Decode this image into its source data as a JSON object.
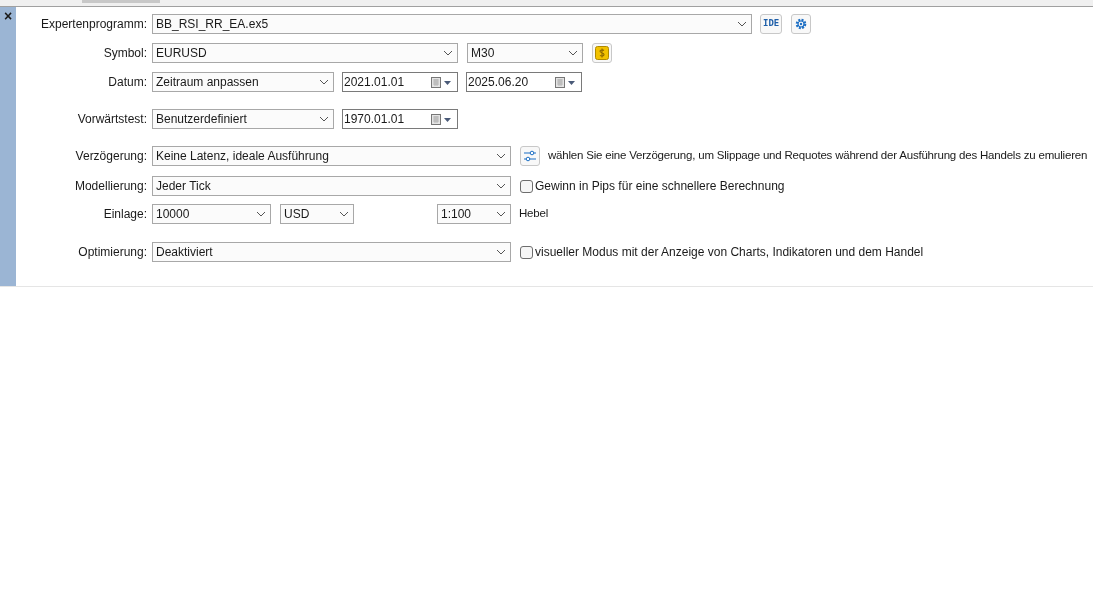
{
  "close_button": "×",
  "form": [
    {
      "label": "Expertenprogramm:",
      "controls": [
        {
          "kind": "combo",
          "value": "BB_RSI_RR_EA.ex5"
        },
        {
          "kind": "ide-button",
          "text": "IDE"
        },
        {
          "kind": "gear-button"
        }
      ]
    },
    {
      "label": "Symbol:",
      "controls": [
        {
          "kind": "combo",
          "value": "EURUSD"
        },
        {
          "kind": "combo",
          "value": "M30"
        },
        {
          "kind": "dollar-button"
        }
      ]
    },
    {
      "label": "Datum:",
      "controls": [
        {
          "kind": "combo",
          "value": "Zeitraum anpassen"
        },
        {
          "kind": "date",
          "value": "2021.01.01"
        },
        {
          "kind": "date",
          "value": "2025.06.20"
        }
      ]
    },
    {
      "label": "Vorwärtstest:",
      "controls": [
        {
          "kind": "combo",
          "value": "Benutzerdefiniert"
        },
        {
          "kind": "date",
          "value": "1970.01.01"
        }
      ]
    },
    {
      "label": "Verzögerung:",
      "controls": [
        {
          "kind": "combo",
          "value": "Keine Latenz, ideale Ausführung"
        },
        {
          "kind": "slider-button"
        },
        {
          "kind": "text",
          "text": "wählen Sie eine Verzögerung, um Slippage und Requotes während der Ausführung des Handels zu emulieren"
        }
      ]
    },
    {
      "label": "Modellierung:",
      "controls": [
        {
          "kind": "combo",
          "value": "Jeder Tick"
        },
        {
          "kind": "checkbox",
          "text": "Gewinn in Pips für eine schnellere Berechnung",
          "checked": false
        }
      ]
    },
    {
      "label": "Einlage:",
      "controls": [
        {
          "kind": "combo",
          "value": "10000"
        },
        {
          "kind": "combo",
          "value": "USD"
        },
        {
          "kind": "combo",
          "value": "1:100"
        },
        {
          "kind": "text",
          "text": "Hebel"
        }
      ]
    },
    {
      "label": "Optimierung:",
      "controls": [
        {
          "kind": "combo",
          "value": "Deaktiviert"
        },
        {
          "kind": "checkbox",
          "text": "visueller Modus mit der Anzeige von Charts, Indikatoren und dem Handel",
          "checked": false
        }
      ]
    }
  ]
}
